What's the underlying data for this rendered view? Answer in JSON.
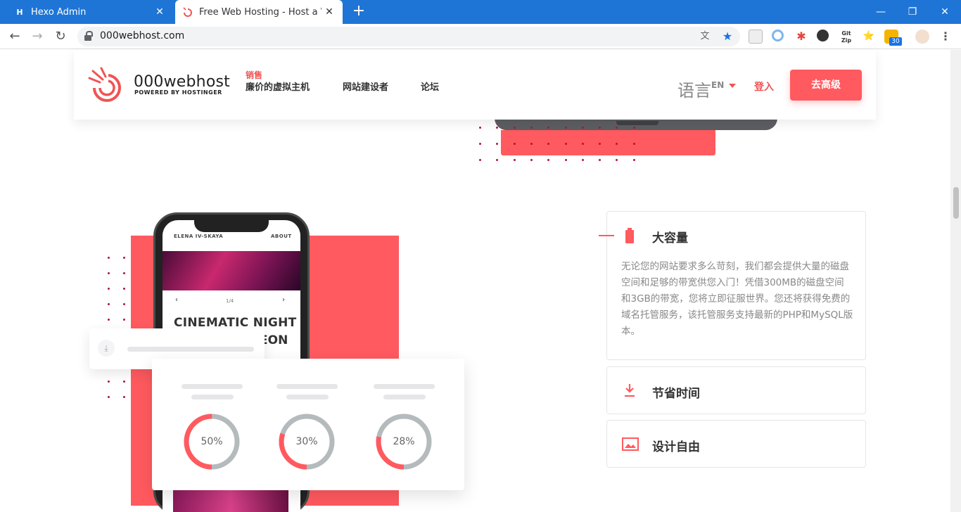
{
  "browser": {
    "tabs": [
      {
        "title": "Hexo Admin",
        "favicon": "H"
      },
      {
        "title": "Free Web Hosting - Host a We"
      }
    ],
    "url": "000webhost.com",
    "ext_badge": "30",
    "ext_gitzip": "Git Zip"
  },
  "site": {
    "logo": {
      "name": "000webhost",
      "tagline": "POWERED BY HOSTINGER"
    },
    "nav": {
      "sale": "销售",
      "items": [
        "廉价的虚拟主机",
        "网站建设者",
        "论坛"
      ],
      "language": "语言",
      "language_code": "EN",
      "login": "登入",
      "upgrade": "去高级"
    },
    "phone": {
      "author": "ELENA IV-SKAYA",
      "about": "ABOUT",
      "page_indicator": "1/4",
      "prev": "‹",
      "next": "›",
      "title_line1": "CINEMATIC NIGHT",
      "title_line2": "EON"
    },
    "stats": [
      {
        "value": "50%",
        "fraction": 0.5
      },
      {
        "value": "30%",
        "fraction": 0.3
      },
      {
        "value": "28%",
        "fraction": 0.28
      }
    ],
    "features": [
      {
        "title": "大容量",
        "description": "无论您的网站要求多么苛刻，我们都会提供大量的磁盘空间和足够的带宽供您入门！凭借300MB的磁盘空间和3GB的带宽，您将立即征服世界。您还将获得免费的域名托管服务，该托管服务支持最新的PHP和MySQL版本。",
        "icon": "battery-icon"
      },
      {
        "title": "节省时间",
        "icon": "download-icon"
      },
      {
        "title": "设计自由",
        "icon": "image-icon"
      }
    ],
    "colors": {
      "accent": "#ff5a5f",
      "dots": "#b0153c",
      "ring_grey": "#b5babd"
    }
  }
}
